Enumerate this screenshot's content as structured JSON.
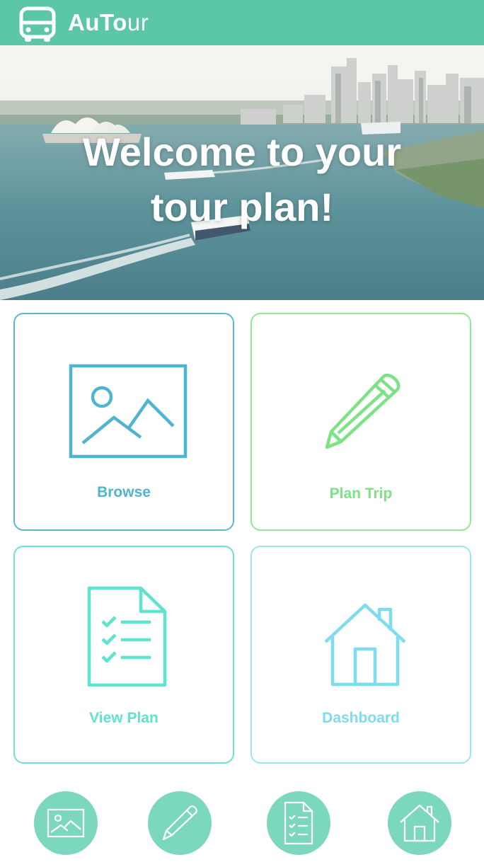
{
  "header": {
    "brand_bold": "AuTo",
    "brand_light": "ur",
    "logo_icon": "bus-icon",
    "background_color": "#5cc7a8"
  },
  "hero": {
    "title_line1": "Welcome to your",
    "title_line2": "tour plan!"
  },
  "cards": {
    "browse": {
      "label": "Browse",
      "icon": "image-icon",
      "color": "#4fb3d2"
    },
    "plan_trip": {
      "label": "Plan Trip",
      "icon": "pencil-icon",
      "color": "#7de286"
    },
    "view_plan": {
      "label": "View Plan",
      "icon": "checklist-icon",
      "color": "#5ee3cf"
    },
    "dashboard": {
      "label": "Dashboard",
      "icon": "house-icon",
      "color": "#7fdcef"
    }
  },
  "bottom_nav": {
    "items": [
      {
        "icon": "image-icon"
      },
      {
        "icon": "pencil-icon"
      },
      {
        "icon": "document-icon"
      },
      {
        "icon": "house-icon"
      }
    ],
    "color": "#7bd8bf"
  }
}
